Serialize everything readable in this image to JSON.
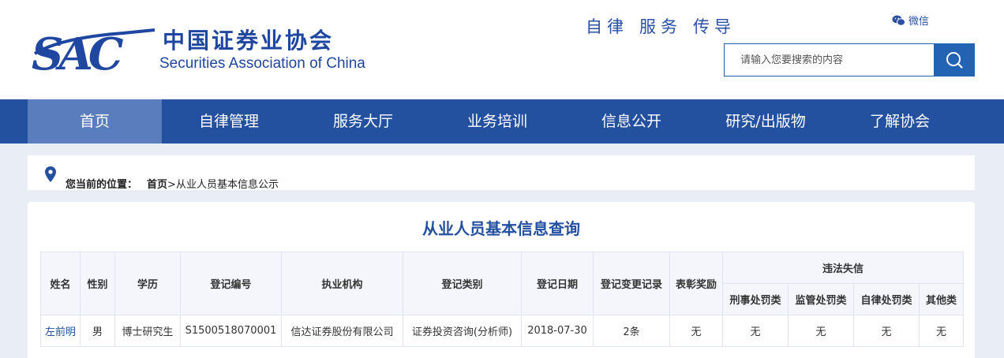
{
  "header": {
    "logo_mark": "SAC",
    "logo_cn": "中国证券业协会",
    "logo_en": "Securities Association of China",
    "slogan": [
      "自律",
      "服务",
      "传导"
    ],
    "weixin_label": "微信",
    "weixin_icon": "wechat-icon",
    "search_placeholder": "请输入您要搜索的内容",
    "search_icon": "search-icon"
  },
  "nav": {
    "items": [
      {
        "label": "首页",
        "active": true
      },
      {
        "label": "自律管理"
      },
      {
        "label": "服务大厅"
      },
      {
        "label": "业务培训"
      },
      {
        "label": "信息公开"
      },
      {
        "label": "研究/出版物"
      },
      {
        "label": "了解协会"
      }
    ]
  },
  "breadcrumb": {
    "icon": "location-pin-icon",
    "label": "您当前的位置：",
    "home": "首页",
    "separator": ">",
    "current": "从业人员基本信息公示"
  },
  "panel": {
    "title": "从业人员基本信息查询"
  },
  "table": {
    "headers": {
      "name": "姓名",
      "gender": "性别",
      "education": "学历",
      "reg_no": "登记编号",
      "org": "执业机构",
      "reg_type": "登记类别",
      "reg_date": "登记日期",
      "change_log": "登记变更记录",
      "awards": "表彰奖励",
      "violations": "违法失信",
      "criminal": "刑事处罚类",
      "regulatory": "监管处罚类",
      "self_reg": "自律处罚类",
      "other": "其他类"
    },
    "rows": [
      {
        "name": "左前明",
        "gender": "男",
        "education": "博士研究生",
        "reg_no": "S1500518070001",
        "org": "信达证券股份有限公司",
        "reg_type": "证券投资咨询(分析师)",
        "reg_date": "2018-07-30",
        "change_log": "2条",
        "awards": "无",
        "criminal": "无",
        "regulatory": "无",
        "self_reg": "无",
        "other": "无"
      }
    ]
  },
  "colors": {
    "brand_blue": "#2450a0",
    "nav_active": "#5a7dbe",
    "page_bg": "#e9edf5"
  }
}
